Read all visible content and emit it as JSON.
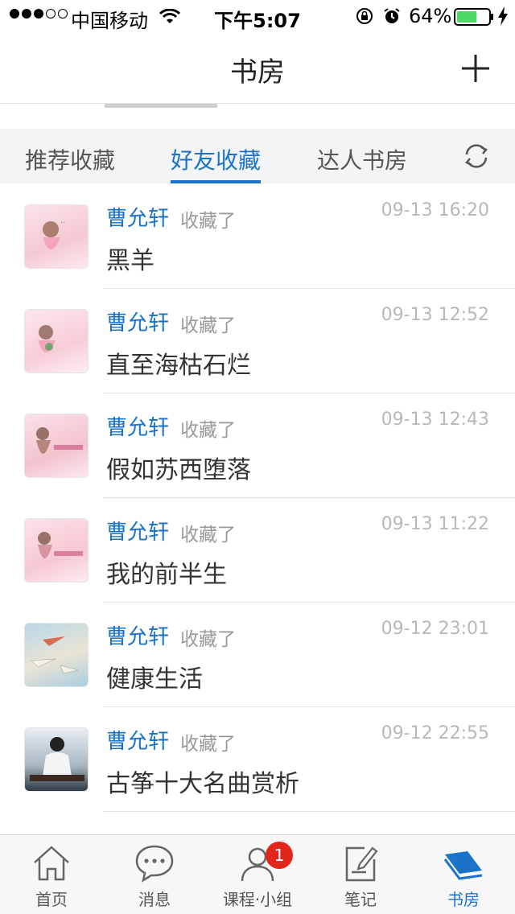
{
  "status_bar": {
    "carrier": "中国移动",
    "time": "下午5:07",
    "battery_percent": "64%",
    "battery_level": 0.64,
    "signal_bars": 3
  },
  "nav": {
    "title": "书房"
  },
  "tabs": [
    {
      "label": "推荐收藏"
    },
    {
      "label": "好友收藏"
    },
    {
      "label": "达人书房"
    }
  ],
  "active_tab": "好友收藏",
  "feed": [
    {
      "user": "曹允轩",
      "action": "收藏了",
      "time": "09-13 16:20",
      "book": "黑羊"
    },
    {
      "user": "曹允轩",
      "action": "收藏了",
      "time": "09-13 12:52",
      "book": "直至海枯石烂"
    },
    {
      "user": "曹允轩",
      "action": "收藏了",
      "time": "09-13 12:43",
      "book": "假如苏西堕落"
    },
    {
      "user": "曹允轩",
      "action": "收藏了",
      "time": "09-13 11:22",
      "book": "我的前半生"
    },
    {
      "user": "曹允轩",
      "action": "收藏了",
      "time": "09-12 23:01",
      "book": "健康生活"
    },
    {
      "user": "曹允轩",
      "action": "收藏了",
      "time": "09-12 22:55",
      "book": "古筝十大名曲赏析"
    }
  ],
  "tabbar": [
    {
      "label": "首页",
      "icon": "home-icon"
    },
    {
      "label": "消息",
      "icon": "chat-bubble-icon"
    },
    {
      "label": "课程·小组",
      "icon": "person-icon",
      "badge": "1"
    },
    {
      "label": "笔记",
      "icon": "note-edit-icon"
    },
    {
      "label": "书房",
      "icon": "bookshelf-icon"
    }
  ],
  "active_tabbar": "书房",
  "colors": {
    "accent": "#1a73c8",
    "badge": "#e3261c",
    "battery": "#4cd964"
  }
}
